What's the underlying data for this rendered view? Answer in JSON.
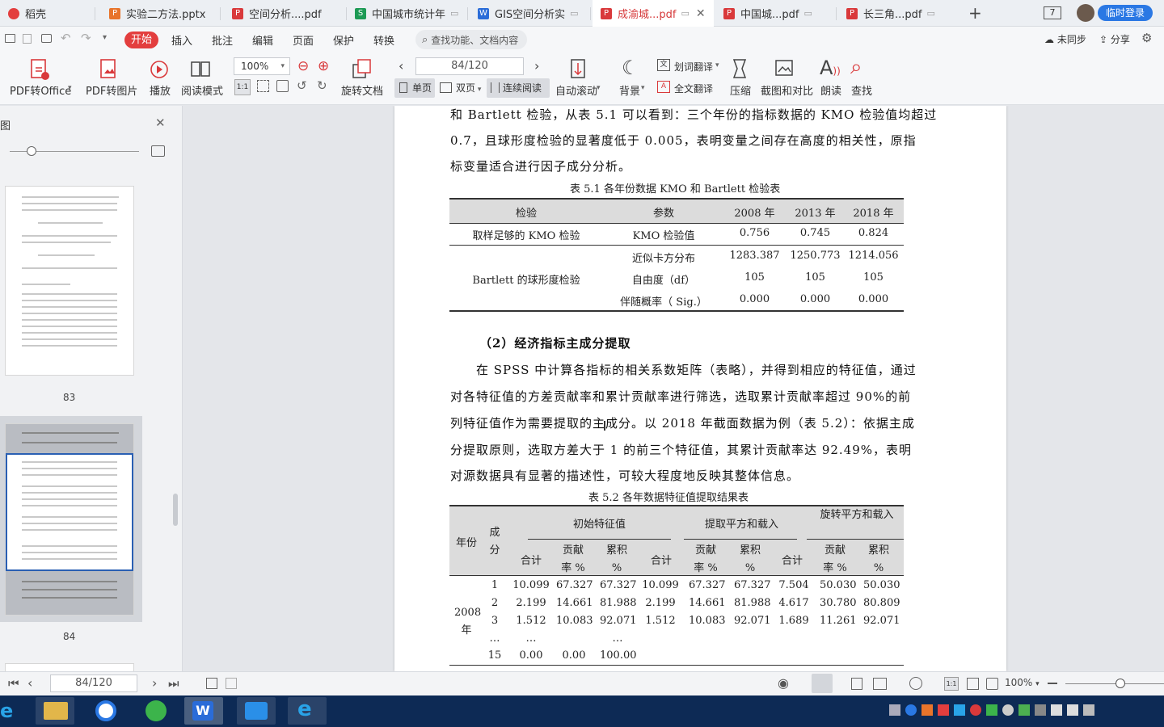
{
  "tabs": [
    {
      "label": "稻壳",
      "type": "home",
      "active": false
    },
    {
      "label": "实验二方法.pptx",
      "type": "ppt",
      "active": false
    },
    {
      "label": "空间分析....pdf",
      "type": "pdf",
      "active": false
    },
    {
      "label": "中国城市统计年",
      "type": "xls",
      "active": false
    },
    {
      "label": "GIS空间分析实",
      "type": "doc",
      "active": false
    },
    {
      "label": "成渝城...pdf",
      "type": "pdf",
      "active": true
    },
    {
      "label": "中国城...pdf",
      "type": "pdf",
      "active": false
    },
    {
      "label": "长三角...pdf",
      "type": "pdf",
      "active": false
    }
  ],
  "titlebar": {
    "new_tab": "+",
    "window_count": "7",
    "login": "临时登录"
  },
  "menu": {
    "start": "开始",
    "items": [
      "插入",
      "批注",
      "编辑",
      "页面",
      "保护",
      "转换"
    ],
    "search": "查找功能、文档内容",
    "sync": "未同步",
    "share": "分享"
  },
  "toolbar": {
    "pdf_to_office": "PDF转Office",
    "pdf_to_image": "PDF转图片",
    "play": "播放",
    "read_mode": "阅读模式",
    "zoom": "100%",
    "page_input": "84/120",
    "rotate": "旋转文档",
    "single_page": "单页",
    "double_page": "双页",
    "continuous": "连续阅读",
    "auto_scroll": "自动滚动",
    "background": "背景",
    "word_translate": "划词翻译",
    "full_translate": "全文翻译",
    "compress": "压缩",
    "screenshot": "截图和对比",
    "read_aloud": "朗读",
    "find": "查找"
  },
  "sidebar": {
    "title": "图",
    "thumb_83": "83",
    "thumb_84": "84"
  },
  "document": {
    "para1_lines": [
      "和 Bartlett 检验，从表 5.1 可以看到：三个年份的指标数据的 KMO 检验值均超过",
      "0.7，且球形度检验的显著度低于 0.005，表明变量之间存在高度的相关性，原指",
      "标变量适合进行因子成分分析。"
    ],
    "table1": {
      "caption": "表 5.1   各年份数据 KMO 和 Bartlett 检验表",
      "headers": [
        "检验",
        "参数",
        "2008 年",
        "2013 年",
        "2018 年"
      ],
      "rows": [
        [
          "取样足够的 KMO 检验",
          "KMO 检验值",
          "0.756",
          "0.745",
          "0.824"
        ],
        [
          "",
          "近似卡方分布",
          "1283.387",
          "1250.773",
          "1214.056"
        ],
        [
          "Bartlett  的球形度检验",
          "自由度（df）",
          "105",
          "105",
          "105"
        ],
        [
          "",
          "伴随概率（ Sig.）",
          "0.000",
          "0.000",
          "0.000"
        ]
      ]
    },
    "heading2": "（2）经济指标主成分提取",
    "para2_lines": [
      "在 SPSS 中计算各指标的相关系数矩阵（表略），并得到相应的特征值，通过",
      "对各特征值的方差贡献率和累计贡献率进行筛选，选取累计贡献率超过 90%的前",
      "列特征值作为需要提取的主成分。以 2018 年截面数据为例（表 5.2）：依据主成",
      "分提取原则，选取方差大于 1 的前三个特征值，其累计贡献率达 92.49%，表明",
      "对源数据具有显著的描述性，可较大程度地反映其整体信息。"
    ],
    "table2": {
      "caption": "表 5.2   各年数据特征值提取结果表",
      "col_year": "年份",
      "col_comp": "成分",
      "groups": [
        "初始特征值",
        "提取平方和载入",
        "旋转平方和载入"
      ],
      "sub_total": "合计",
      "sub_rate": "贡献率 %",
      "sub_cum": "累积 %",
      "year_label": "2008 年",
      "rows": [
        [
          "1",
          "10.099",
          "67.327",
          "67.327",
          "10.099",
          "67.327",
          "67.327",
          "7.504",
          "50.030",
          "50.030"
        ],
        [
          "2",
          "2.199",
          "14.661",
          "81.988",
          "2.199",
          "14.661",
          "81.988",
          "4.617",
          "30.780",
          "80.809"
        ],
        [
          "3",
          "1.512",
          "10.083",
          "92.071",
          "1.512",
          "10.083",
          "92.071",
          "1.689",
          "11.261",
          "92.071"
        ],
        [
          "…",
          "…",
          "",
          "…",
          "",
          "",
          "",
          "",
          "",
          ""
        ],
        [
          "15",
          "0.00",
          "0.00",
          "100.00",
          "",
          "",
          "",
          "",
          "",
          ""
        ]
      ]
    }
  },
  "status": {
    "page": "84/120",
    "zoom": "100%"
  },
  "colors": {
    "accent": "#e33e3e",
    "taskbar": "#0d2a55",
    "login": "#2a78e4"
  }
}
